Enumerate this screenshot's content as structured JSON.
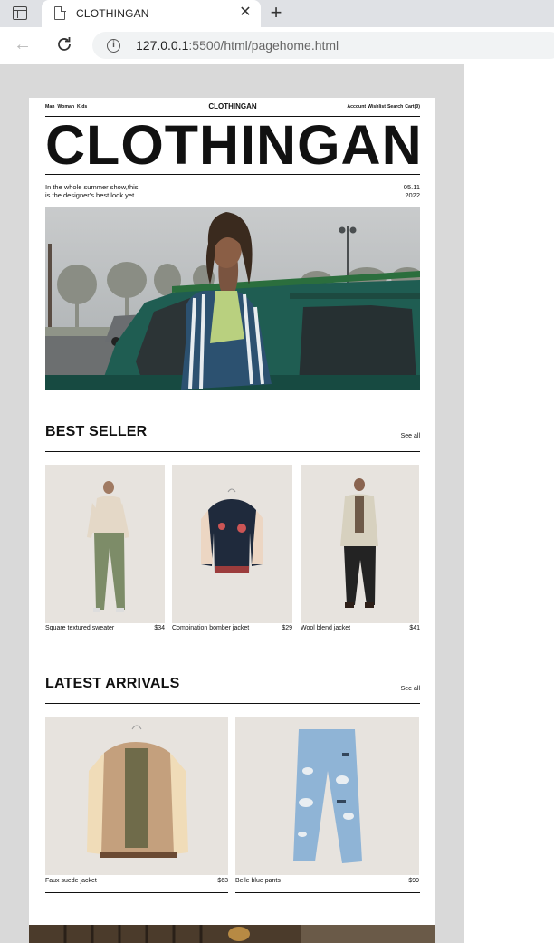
{
  "browser": {
    "tab_title": "CLOTHINGAN",
    "url_host": "127.0.0.1",
    "url_rest": ":5500/html/pagehome.html"
  },
  "nav": {
    "left": [
      "Man",
      "Woman",
      "Kids"
    ],
    "brand": "CLOTHINGAN",
    "right": [
      "Account",
      "Wishlist",
      "Search",
      "Cart(0)"
    ]
  },
  "hero": {
    "title": "CLOTHINGAN",
    "intro_line1": "In the whole summer show,this",
    "intro_line2": "is the designer's best look yet",
    "date_line1": "05.11",
    "date_line2": "2022"
  },
  "best_seller": {
    "title": "BEST SELLER",
    "see_all": "See all",
    "products": [
      {
        "name": "Square textured sweater",
        "price": "$34"
      },
      {
        "name": "Combination bomber jacket",
        "price": "$29"
      },
      {
        "name": "Wool blend jacket",
        "price": "$41"
      }
    ]
  },
  "latest": {
    "title": "LATEST ARRIVALS",
    "see_all": "See all",
    "products": [
      {
        "name": "Faux suede jacket",
        "price": "$63"
      },
      {
        "name": "Belle blue pants",
        "price": "$99"
      }
    ]
  }
}
